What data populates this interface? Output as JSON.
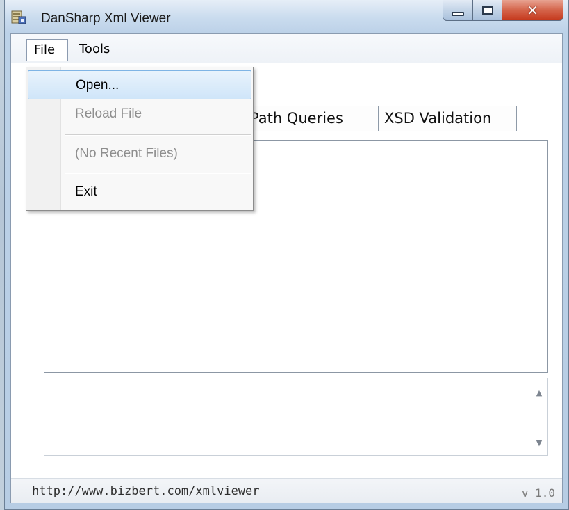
{
  "window": {
    "title": "DanSharp Xml Viewer"
  },
  "menubar": {
    "file": "File",
    "tools": "Tools"
  },
  "file_menu": {
    "open": "Open...",
    "reload": "Reload File",
    "recent": "(No Recent Files)",
    "exit": "Exit"
  },
  "tabs": {
    "xpath": "Path Queries",
    "xsd": "XSD Validation"
  },
  "status": {
    "url": "http://www.bizbert.com/xmlviewer",
    "version": "v 1.0"
  },
  "colors": {
    "highlight": "#cfe5f9",
    "close_button": "#d4644a"
  },
  "icons": {
    "app": "xml-tools-icon"
  }
}
